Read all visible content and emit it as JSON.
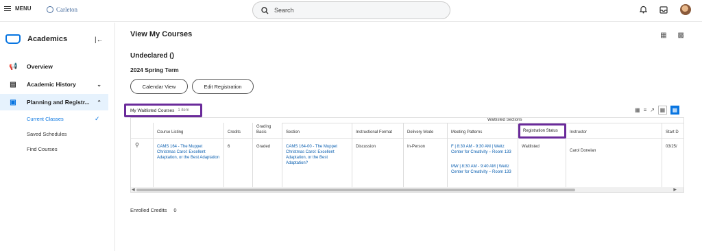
{
  "topbar": {
    "menu_label": "MENU",
    "logo_text": "Carleton",
    "search_placeholder": "Search",
    "icons": [
      "bell-icon",
      "inbox-icon",
      "avatar"
    ]
  },
  "sidebar": {
    "title": "Academics",
    "items": [
      {
        "label": "Overview",
        "icon": "megaphone-icon"
      },
      {
        "label": "Academic History",
        "icon": "history-icon",
        "chevron": "down"
      },
      {
        "label": "Planning and Registr...",
        "icon": "calendar-icon",
        "chevron": "up",
        "active": true
      }
    ],
    "sub_items": [
      {
        "label": "Current Classes",
        "current": true
      },
      {
        "label": "Saved Schedules"
      },
      {
        "label": "Find Courses"
      }
    ]
  },
  "main": {
    "page_title": "View My Courses",
    "status": "Undeclared ()",
    "term": "2024 Spring Term",
    "buttons": {
      "calendar": "Calendar View",
      "edit": "Edit Registration"
    },
    "waitlist": {
      "title": "My Waitlisted Courses",
      "count": "1 item"
    },
    "table": {
      "group_header": "Waitlisted Sections",
      "headers": {
        "course": "Course Listing",
        "credits": "Credits",
        "grading": "Grading Basis",
        "section": "Section",
        "format": "Instructional Format",
        "delivery": "Delivery Mode",
        "meeting": "Meeting Patterns",
        "reg_status": "Registration Status",
        "instructor": "Instructor",
        "start": "Start D"
      },
      "row": {
        "course": "CAMS 164 - The Muppet Christmas Carol: Excellent Adaptation, or the Best Adaptation",
        "credits": "6",
        "grading": "Graded",
        "section": "CAMS 164-00 - The Muppet Christmas Carol: Excellent Adaptation, or the Best Adaptation?",
        "format": "Discussion",
        "delivery": "In-Person",
        "meeting_1": "F | 8:30 AM - 9:30 AM | Weitz Center for Creativity – Room 133",
        "meeting_2": "MW | 8:30 AM - 9:40 AM | Weitz Center for Creativity – Room 133",
        "reg_status": "Waitlisted",
        "instructor": "Carol Donelan",
        "start": "03/25/"
      }
    },
    "enrolled_credits": {
      "label": "Enrolled Credits",
      "value": "0"
    }
  },
  "colors": {
    "accent": "#0875e1",
    "highlight": "#6a2a9a",
    "link": "#0a5fb0"
  }
}
